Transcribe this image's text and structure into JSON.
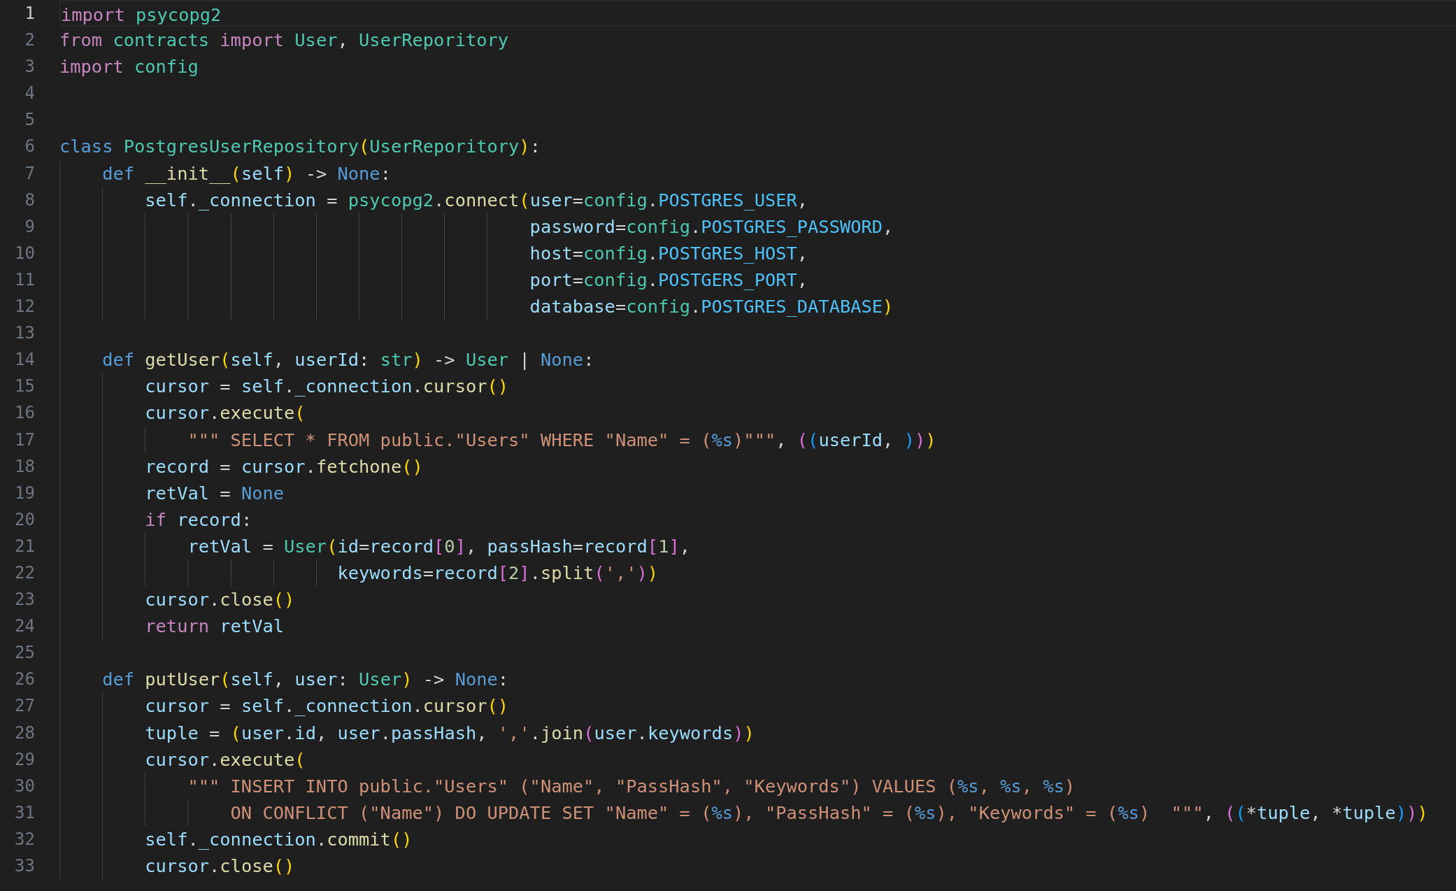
{
  "editor": {
    "lines": [
      {
        "number": "1",
        "active": true,
        "tokens": [
          {
            "kind": "kw",
            "text": "import "
          },
          {
            "kind": "cls",
            "text": "psycopg2"
          }
        ]
      },
      {
        "number": "2",
        "active": false,
        "tokens": [
          {
            "kind": "kw",
            "text": "from "
          },
          {
            "kind": "cls",
            "text": "contracts "
          },
          {
            "kind": "kw",
            "text": "import "
          },
          {
            "kind": "cls",
            "text": "User"
          },
          {
            "kind": "op",
            "text": ", "
          },
          {
            "kind": "cls",
            "text": "UserReporitory"
          }
        ]
      },
      {
        "number": "3",
        "active": false,
        "tokens": [
          {
            "kind": "kw",
            "text": "import "
          },
          {
            "kind": "cls",
            "text": "config"
          }
        ]
      },
      {
        "number": "4",
        "active": false
      },
      {
        "number": "5",
        "active": false
      },
      {
        "number": "6",
        "active": false,
        "tokens": [
          {
            "kind": "st",
            "text": "class "
          },
          {
            "kind": "cls",
            "text": "PostgresUserRepository"
          },
          {
            "kind": "b1",
            "text": "("
          },
          {
            "kind": "cls",
            "text": "UserReporitory"
          },
          {
            "kind": "b1",
            "text": ")"
          },
          {
            "kind": "op",
            "text": ":"
          }
        ]
      },
      {
        "number": "7",
        "active": false,
        "tokens": [
          {
            "kind": "st",
            "text": "    def "
          },
          {
            "kind": "fn",
            "text": "__init__"
          },
          {
            "kind": "b1",
            "text": "("
          },
          {
            "kind": "var",
            "text": "self"
          },
          {
            "kind": "b1",
            "text": ")"
          },
          {
            "kind": "op",
            "text": " -> "
          },
          {
            "kind": "st",
            "text": "None"
          },
          {
            "kind": "op",
            "text": ":"
          }
        ]
      },
      {
        "number": "8",
        "active": false,
        "tokens": [
          {
            "kind": "var",
            "text": "        self"
          },
          {
            "kind": "op",
            "text": "."
          },
          {
            "kind": "var",
            "text": "_connection"
          },
          {
            "kind": "op",
            "text": " = "
          },
          {
            "kind": "cls",
            "text": "psycopg2"
          },
          {
            "kind": "op",
            "text": "."
          },
          {
            "kind": "fn",
            "text": "connect"
          },
          {
            "kind": "b1",
            "text": "("
          },
          {
            "kind": "var",
            "text": "user"
          },
          {
            "kind": "op",
            "text": "="
          },
          {
            "kind": "cls",
            "text": "config"
          },
          {
            "kind": "op",
            "text": "."
          },
          {
            "kind": "cst",
            "text": "POSTGRES_USER"
          },
          {
            "kind": "op",
            "text": ","
          }
        ]
      },
      {
        "number": "9",
        "active": false,
        "tokens": [
          {
            "kind": "var",
            "text": "                                            password"
          },
          {
            "kind": "op",
            "text": "="
          },
          {
            "kind": "cls",
            "text": "config"
          },
          {
            "kind": "op",
            "text": "."
          },
          {
            "kind": "cst",
            "text": "POSTGRES_PASSWORD"
          },
          {
            "kind": "op",
            "text": ","
          }
        ]
      },
      {
        "number": "10",
        "active": false,
        "tokens": [
          {
            "kind": "var",
            "text": "                                            host"
          },
          {
            "kind": "op",
            "text": "="
          },
          {
            "kind": "cls",
            "text": "config"
          },
          {
            "kind": "op",
            "text": "."
          },
          {
            "kind": "cst",
            "text": "POSTGRES_HOST"
          },
          {
            "kind": "op",
            "text": ","
          }
        ]
      },
      {
        "number": "11",
        "active": false,
        "tokens": [
          {
            "kind": "var",
            "text": "                                            port"
          },
          {
            "kind": "op",
            "text": "="
          },
          {
            "kind": "cls",
            "text": "config"
          },
          {
            "kind": "op",
            "text": "."
          },
          {
            "kind": "cst",
            "text": "POSTGERS_PORT"
          },
          {
            "kind": "op",
            "text": ","
          }
        ]
      },
      {
        "number": "12",
        "active": false,
        "tokens": [
          {
            "kind": "var",
            "text": "                                            database"
          },
          {
            "kind": "op",
            "text": "="
          },
          {
            "kind": "cls",
            "text": "config"
          },
          {
            "kind": "op",
            "text": "."
          },
          {
            "kind": "cst",
            "text": "POSTGRES_DATABASE"
          },
          {
            "kind": "b1",
            "text": ")"
          }
        ]
      },
      {
        "number": "13",
        "active": false
      },
      {
        "number": "14",
        "active": false,
        "tokens": [
          {
            "kind": "st",
            "text": "    def "
          },
          {
            "kind": "fn",
            "text": "getUser"
          },
          {
            "kind": "b1",
            "text": "("
          },
          {
            "kind": "var",
            "text": "self"
          },
          {
            "kind": "op",
            "text": ", "
          },
          {
            "kind": "var",
            "text": "userId"
          },
          {
            "kind": "op",
            "text": ": "
          },
          {
            "kind": "cls",
            "text": "str"
          },
          {
            "kind": "b1",
            "text": ")"
          },
          {
            "kind": "op",
            "text": " -> "
          },
          {
            "kind": "cls",
            "text": "User"
          },
          {
            "kind": "op",
            "text": " | "
          },
          {
            "kind": "st",
            "text": "None"
          },
          {
            "kind": "op",
            "text": ":"
          }
        ]
      },
      {
        "number": "15",
        "active": false,
        "tokens": [
          {
            "kind": "var",
            "text": "        cursor"
          },
          {
            "kind": "op",
            "text": " = "
          },
          {
            "kind": "var",
            "text": "self"
          },
          {
            "kind": "op",
            "text": "."
          },
          {
            "kind": "var",
            "text": "_connection"
          },
          {
            "kind": "op",
            "text": "."
          },
          {
            "kind": "fn",
            "text": "cursor"
          },
          {
            "kind": "b1",
            "text": "()"
          }
        ]
      },
      {
        "number": "16",
        "active": false,
        "tokens": [
          {
            "kind": "var",
            "text": "        cursor"
          },
          {
            "kind": "op",
            "text": "."
          },
          {
            "kind": "fn",
            "text": "execute"
          },
          {
            "kind": "b1",
            "text": "("
          }
        ]
      },
      {
        "number": "17",
        "active": false,
        "tokens": [
          {
            "kind": "str",
            "text": "            \"\"\" SELECT * FROM public.\"Users\" WHERE \"Name\" = ("
          },
          {
            "kind": "fmt",
            "text": "%s"
          },
          {
            "kind": "str",
            "text": ")\"\"\""
          },
          {
            "kind": "op",
            "text": ", "
          },
          {
            "kind": "b2",
            "text": "("
          },
          {
            "kind": "b3",
            "text": "("
          },
          {
            "kind": "var",
            "text": "userId"
          },
          {
            "kind": "op",
            "text": ", "
          },
          {
            "kind": "b3",
            "text": ")"
          },
          {
            "kind": "b2",
            "text": ")"
          },
          {
            "kind": "b1",
            "text": ")"
          }
        ]
      },
      {
        "number": "18",
        "active": false,
        "tokens": [
          {
            "kind": "var",
            "text": "        record"
          },
          {
            "kind": "op",
            "text": " = "
          },
          {
            "kind": "var",
            "text": "cursor"
          },
          {
            "kind": "op",
            "text": "."
          },
          {
            "kind": "fn",
            "text": "fetchone"
          },
          {
            "kind": "b1",
            "text": "()"
          }
        ]
      },
      {
        "number": "19",
        "active": false,
        "tokens": [
          {
            "kind": "var",
            "text": "        retVal"
          },
          {
            "kind": "op",
            "text": " = "
          },
          {
            "kind": "st",
            "text": "None"
          }
        ]
      },
      {
        "number": "20",
        "active": false,
        "tokens": [
          {
            "kind": "kw",
            "text": "        if "
          },
          {
            "kind": "var",
            "text": "record"
          },
          {
            "kind": "op",
            "text": ":"
          }
        ]
      },
      {
        "number": "21",
        "active": false,
        "tokens": [
          {
            "kind": "var",
            "text": "            retVal"
          },
          {
            "kind": "op",
            "text": " = "
          },
          {
            "kind": "cls",
            "text": "User"
          },
          {
            "kind": "b1",
            "text": "("
          },
          {
            "kind": "var",
            "text": "id"
          },
          {
            "kind": "op",
            "text": "="
          },
          {
            "kind": "var",
            "text": "record"
          },
          {
            "kind": "b2",
            "text": "["
          },
          {
            "kind": "num",
            "text": "0"
          },
          {
            "kind": "b2",
            "text": "]"
          },
          {
            "kind": "op",
            "text": ", "
          },
          {
            "kind": "var",
            "text": "passHash"
          },
          {
            "kind": "op",
            "text": "="
          },
          {
            "kind": "var",
            "text": "record"
          },
          {
            "kind": "b2",
            "text": "["
          },
          {
            "kind": "num",
            "text": "1"
          },
          {
            "kind": "b2",
            "text": "]"
          },
          {
            "kind": "op",
            "text": ","
          }
        ]
      },
      {
        "number": "22",
        "active": false,
        "tokens": [
          {
            "kind": "var",
            "text": "                          keywords"
          },
          {
            "kind": "op",
            "text": "="
          },
          {
            "kind": "var",
            "text": "record"
          },
          {
            "kind": "b2",
            "text": "["
          },
          {
            "kind": "num",
            "text": "2"
          },
          {
            "kind": "b2",
            "text": "]"
          },
          {
            "kind": "op",
            "text": "."
          },
          {
            "kind": "fn",
            "text": "split"
          },
          {
            "kind": "b2",
            "text": "("
          },
          {
            "kind": "str",
            "text": "','"
          },
          {
            "kind": "b2",
            "text": ")"
          },
          {
            "kind": "b1",
            "text": ")"
          }
        ]
      },
      {
        "number": "23",
        "active": false,
        "tokens": [
          {
            "kind": "var",
            "text": "        cursor"
          },
          {
            "kind": "op",
            "text": "."
          },
          {
            "kind": "fn",
            "text": "close"
          },
          {
            "kind": "b1",
            "text": "()"
          }
        ]
      },
      {
        "number": "24",
        "active": false,
        "tokens": [
          {
            "kind": "kw",
            "text": "        return "
          },
          {
            "kind": "var",
            "text": "retVal"
          }
        ]
      },
      {
        "number": "25",
        "active": false
      },
      {
        "number": "26",
        "active": false,
        "tokens": [
          {
            "kind": "st",
            "text": "    def "
          },
          {
            "kind": "fn",
            "text": "putUser"
          },
          {
            "kind": "b1",
            "text": "("
          },
          {
            "kind": "var",
            "text": "self"
          },
          {
            "kind": "op",
            "text": ", "
          },
          {
            "kind": "var",
            "text": "user"
          },
          {
            "kind": "op",
            "text": ": "
          },
          {
            "kind": "cls",
            "text": "User"
          },
          {
            "kind": "b1",
            "text": ")"
          },
          {
            "kind": "op",
            "text": " -> "
          },
          {
            "kind": "st",
            "text": "None"
          },
          {
            "kind": "op",
            "text": ":"
          }
        ]
      },
      {
        "number": "27",
        "active": false,
        "tokens": [
          {
            "kind": "var",
            "text": "        cursor"
          },
          {
            "kind": "op",
            "text": " = "
          },
          {
            "kind": "var",
            "text": "self"
          },
          {
            "kind": "op",
            "text": "."
          },
          {
            "kind": "var",
            "text": "_connection"
          },
          {
            "kind": "op",
            "text": "."
          },
          {
            "kind": "fn",
            "text": "cursor"
          },
          {
            "kind": "b1",
            "text": "()"
          }
        ]
      },
      {
        "number": "28",
        "active": false,
        "tokens": [
          {
            "kind": "var",
            "text": "        tuple"
          },
          {
            "kind": "op",
            "text": " = "
          },
          {
            "kind": "b1",
            "text": "("
          },
          {
            "kind": "var",
            "text": "user"
          },
          {
            "kind": "op",
            "text": "."
          },
          {
            "kind": "var",
            "text": "id"
          },
          {
            "kind": "op",
            "text": ", "
          },
          {
            "kind": "var",
            "text": "user"
          },
          {
            "kind": "op",
            "text": "."
          },
          {
            "kind": "var",
            "text": "passHash"
          },
          {
            "kind": "op",
            "text": ", "
          },
          {
            "kind": "str",
            "text": "','"
          },
          {
            "kind": "op",
            "text": "."
          },
          {
            "kind": "fn",
            "text": "join"
          },
          {
            "kind": "b2",
            "text": "("
          },
          {
            "kind": "var",
            "text": "user"
          },
          {
            "kind": "op",
            "text": "."
          },
          {
            "kind": "var",
            "text": "keywords"
          },
          {
            "kind": "b2",
            "text": ")"
          },
          {
            "kind": "b1",
            "text": ")"
          }
        ]
      },
      {
        "number": "29",
        "active": false,
        "tokens": [
          {
            "kind": "var",
            "text": "        cursor"
          },
          {
            "kind": "op",
            "text": "."
          },
          {
            "kind": "fn",
            "text": "execute"
          },
          {
            "kind": "b1",
            "text": "("
          }
        ]
      },
      {
        "number": "30",
        "active": false,
        "tokens": [
          {
            "kind": "str",
            "text": "            \"\"\" INSERT INTO public.\"Users\" (\"Name\", \"PassHash\", \"Keywords\") VALUES ("
          },
          {
            "kind": "fmt",
            "text": "%s"
          },
          {
            "kind": "str",
            "text": ", "
          },
          {
            "kind": "fmt",
            "text": "%s"
          },
          {
            "kind": "str",
            "text": ", "
          },
          {
            "kind": "fmt",
            "text": "%s"
          },
          {
            "kind": "str",
            "text": ")"
          }
        ]
      },
      {
        "number": "31",
        "active": false,
        "tokens": [
          {
            "kind": "str",
            "text": "                ON CONFLICT (\"Name\") DO UPDATE SET \"Name\" = ("
          },
          {
            "kind": "fmt",
            "text": "%s"
          },
          {
            "kind": "str",
            "text": "), \"PassHash\" = ("
          },
          {
            "kind": "fmt",
            "text": "%s"
          },
          {
            "kind": "str",
            "text": "), \"Keywords\" = ("
          },
          {
            "kind": "fmt",
            "text": "%s"
          },
          {
            "kind": "str",
            "text": ")  \"\"\""
          },
          {
            "kind": "op",
            "text": ", "
          },
          {
            "kind": "b2",
            "text": "("
          },
          {
            "kind": "b3",
            "text": "("
          },
          {
            "kind": "op",
            "text": "*"
          },
          {
            "kind": "var",
            "text": "tuple"
          },
          {
            "kind": "op",
            "text": ", *"
          },
          {
            "kind": "var",
            "text": "tuple"
          },
          {
            "kind": "b3",
            "text": ")"
          },
          {
            "kind": "b2",
            "text": ")"
          },
          {
            "kind": "b1",
            "text": ")"
          }
        ]
      },
      {
        "number": "32",
        "active": false,
        "tokens": [
          {
            "kind": "var",
            "text": "        self"
          },
          {
            "kind": "op",
            "text": "."
          },
          {
            "kind": "var",
            "text": "_connection"
          },
          {
            "kind": "op",
            "text": "."
          },
          {
            "kind": "fn",
            "text": "commit"
          },
          {
            "kind": "b1",
            "text": "()"
          }
        ]
      },
      {
        "number": "33",
        "active": false,
        "tokens": [
          {
            "kind": "var",
            "text": "        cursor"
          },
          {
            "kind": "op",
            "text": "."
          },
          {
            "kind": "fn",
            "text": "close"
          },
          {
            "kind": "b1",
            "text": "()"
          }
        ]
      }
    ]
  }
}
